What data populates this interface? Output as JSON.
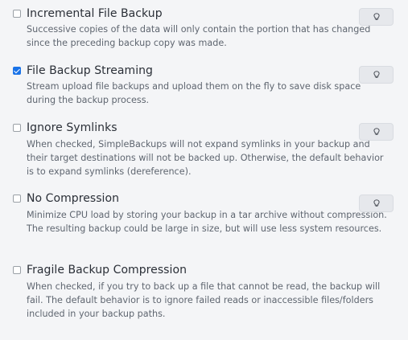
{
  "options": [
    {
      "title": "Incremental File Backup",
      "description": "Successive copies of the data will only contain the portion that has changed since the preceding backup copy was made.",
      "checked": false,
      "hint_icon": "lightbulb-icon"
    },
    {
      "title": "File Backup Streaming",
      "description": "Stream upload file backups and upload them on the fly to save disk space during the backup process.",
      "checked": true,
      "hint_icon": "lightbulb-icon"
    },
    {
      "title": "Ignore Symlinks",
      "description": "When checked, SimpleBackups will not expand symlinks in your backup and their target destinations will not be backed up. Otherwise, the default behavior is to expand symlinks (dereference).",
      "checked": false,
      "hint_icon": "lightbulb-icon"
    },
    {
      "title": "No Compression",
      "description": "Minimize CPU load by storing your backup in a tar archive without compression. The resulting backup could be large in size, but will use less system resources.",
      "checked": false,
      "hint_icon": "lightbulb-icon"
    },
    {
      "title": "Fragile Backup Compression",
      "description": "When checked, if you try to back up a file that cannot be read, the backup will fail. The default behavior is to ignore failed reads or inaccessible files/folders included in your backup paths.",
      "checked": false
    }
  ],
  "colors": {
    "accent": "#1a73e8",
    "background": "#f4f5f7",
    "hint_button": "#e6e8ec"
  }
}
